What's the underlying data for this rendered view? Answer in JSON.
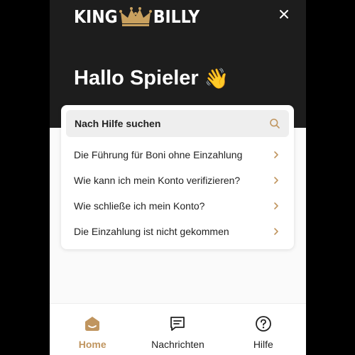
{
  "brand": {
    "logo_left": "KING",
    "logo_right": "BILLY",
    "logo_color": "#ffffff",
    "crown_color": "#c9a15f"
  },
  "hero": {
    "greeting": "Hallo Spieler",
    "greeting_emoji": "👋",
    "background": "#1d1d1d"
  },
  "search": {
    "label": "Nach Hilfe suchen",
    "icon": "search-icon"
  },
  "faq": {
    "items": [
      {
        "label": "Die Führung für Boni ohne Einzahlung"
      },
      {
        "label": "Wie kann ich mein Konto verifizieren?"
      },
      {
        "label": "Wie schließe ich mein Konto?"
      },
      {
        "label": "Die Einzahlung ist nicht gekommen"
      }
    ]
  },
  "tabs": [
    {
      "label": "Home",
      "icon": "home-icon",
      "active": true
    },
    {
      "label": "Nachrichten",
      "icon": "messages-icon",
      "active": false
    },
    {
      "label": "Hilfe",
      "icon": "help-icon",
      "active": false
    }
  ],
  "colors": {
    "accent": "#c0955f",
    "panel_bg": "#fafafa",
    "card_bg": "#ffffff"
  }
}
